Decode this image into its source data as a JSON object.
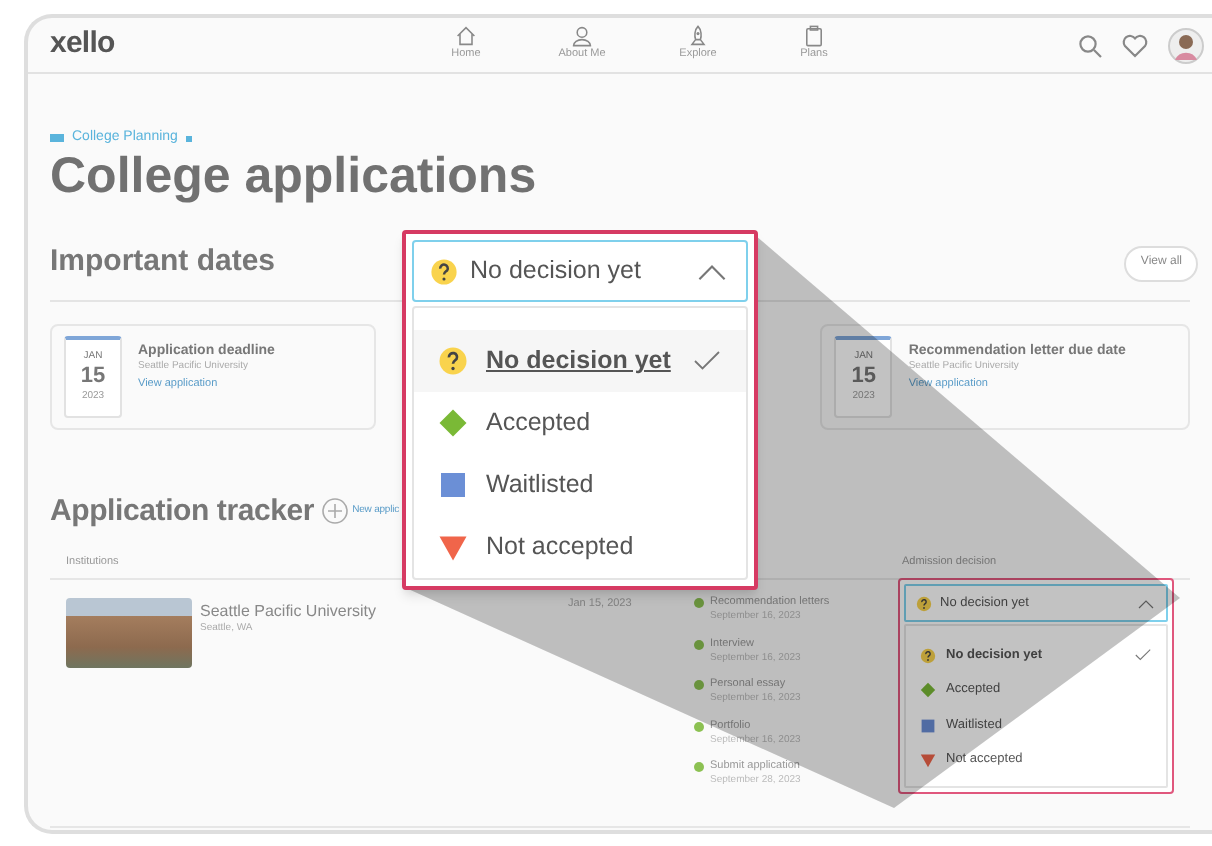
{
  "nav": {
    "logo": "xello",
    "items": [
      {
        "label": "Home",
        "kind": "home"
      },
      {
        "label": "About Me",
        "kind": "person"
      },
      {
        "label": "Explore",
        "kind": "rocket"
      },
      {
        "label": "Plans",
        "kind": "clipboard"
      }
    ]
  },
  "breadcrumb": "College Planning",
  "title": "College applications",
  "important_dates": {
    "heading": "Important dates",
    "view_all": "View all",
    "cards": [
      {
        "month": "JAN",
        "day": "15",
        "year": "2023",
        "title": "Application deadline",
        "school": "Seattle Pacific University",
        "link": "View application"
      },
      {
        "month": "JAN",
        "day": "15",
        "year": "2023",
        "title": "Recommendation letter due date",
        "school": "Seattle Pacific University",
        "link": "View application"
      }
    ]
  },
  "tracker": {
    "heading": "Application tracker",
    "new_button": "New applic",
    "columns": [
      "Institutions",
      "Admission decision"
    ],
    "rows": [
      {
        "name": "Seattle Pacific University",
        "location": "Seattle, WA",
        "date": "Jan 15, 2023",
        "tasks": [
          {
            "label": "Recommendation letters",
            "date": "September 16, 2023",
            "done": true
          },
          {
            "label": "Interview",
            "date": "September 16, 2023",
            "done": true
          },
          {
            "label": "Personal essay",
            "date": "September 16, 2023",
            "done": true
          },
          {
            "label": "Portfolio",
            "date": "September 16, 2023",
            "done": true
          },
          {
            "label": "Submit application",
            "date": "September 28, 2023",
            "done": true
          }
        ],
        "decision": {
          "value": "No decision yet",
          "kind": "pending",
          "expanded": true,
          "options": [
            {
              "label": "No decision yet",
              "kind": "pending",
              "selected": true
            },
            {
              "label": "Accepted",
              "kind": "accepted",
              "selected": false
            },
            {
              "label": "Waitlisted",
              "kind": "waitlisted",
              "selected": false
            },
            {
              "label": "Not accepted",
              "kind": "rejected",
              "selected": false
            }
          ]
        }
      }
    ]
  },
  "callout": {
    "value": "No decision yet",
    "kind": "pending",
    "expanded": true,
    "options": [
      {
        "label": "No decision yet",
        "kind": "pending",
        "selected": true
      },
      {
        "label": "Accepted",
        "kind": "accepted",
        "selected": false
      },
      {
        "label": "Waitlisted",
        "kind": "waitlisted",
        "selected": false
      },
      {
        "label": "Not accepted",
        "kind": "rejected",
        "selected": false
      }
    ]
  }
}
